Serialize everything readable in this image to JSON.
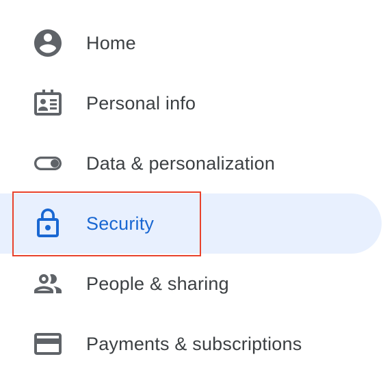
{
  "nav": {
    "items": [
      {
        "label": "Home",
        "icon": "account-circle-icon",
        "active": false
      },
      {
        "label": "Personal info",
        "icon": "id-card-icon",
        "active": false
      },
      {
        "label": "Data & personalization",
        "icon": "toggle-icon",
        "active": false
      },
      {
        "label": "Security",
        "icon": "lock-icon",
        "active": true
      },
      {
        "label": "People & sharing",
        "icon": "people-icon",
        "active": false
      },
      {
        "label": "Payments & subscriptions",
        "icon": "credit-card-icon",
        "active": false
      }
    ]
  },
  "colors": {
    "text": "#3c4043",
    "icon": "#5f6368",
    "active_text": "#1967d2",
    "active_bg": "#e8f0fe",
    "highlight_border": "#e8412b"
  }
}
